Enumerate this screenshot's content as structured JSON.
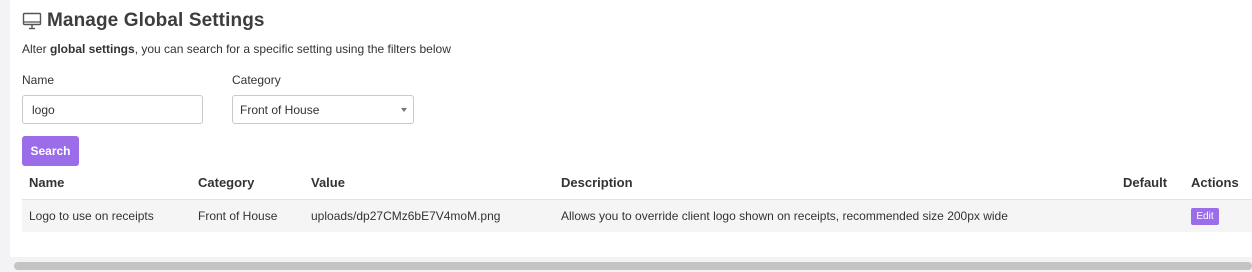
{
  "page": {
    "title_prefix": "Manage ",
    "title_strong": "Global Settings",
    "subtitle_prefix": "Alter ",
    "subtitle_strong": "global settings",
    "subtitle_suffix": ", you can search for a specific setting using the filters below",
    "icon": "monitor-icon"
  },
  "filters": {
    "name_label": "Name",
    "name_value": "logo",
    "category_label": "Category",
    "category_value": "Front of House",
    "search_label": "Search"
  },
  "table": {
    "headers": [
      "Name",
      "Category",
      "Value",
      "Description",
      "Default",
      "Actions"
    ],
    "rows": [
      {
        "name": "Logo to use on receipts",
        "category": "Front of House",
        "value": "uploads/dp27CMz6bE7V4moM.png",
        "description": "Allows you to override client logo shown on receipts, recommended size 200px wide",
        "default": "",
        "action_label": "Edit"
      }
    ]
  },
  "colors": {
    "accent": "#9b6de8",
    "row_bg": "#f5f5f5",
    "page_bg": "#f3f3f5"
  }
}
